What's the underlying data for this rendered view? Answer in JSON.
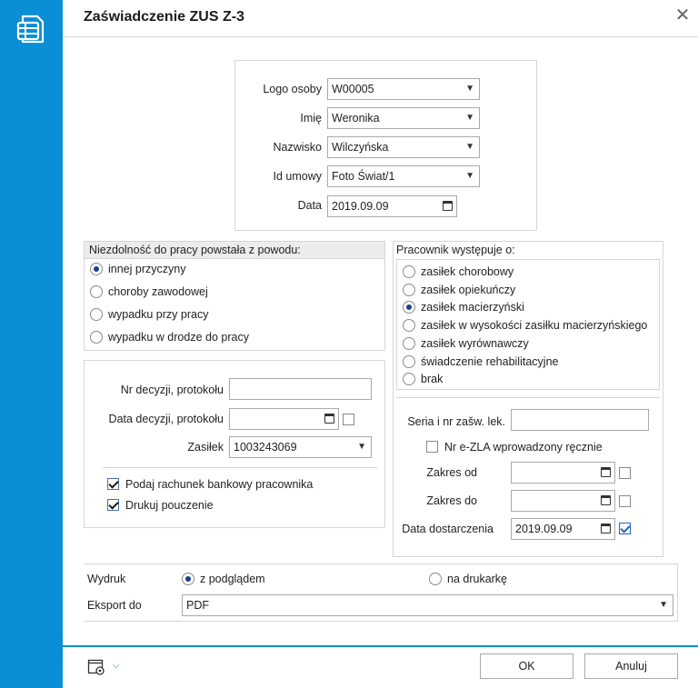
{
  "window": {
    "title": "Zaświadczenie ZUS Z-3",
    "close": "✕"
  },
  "header_fields": {
    "logo_label": "Logo osoby",
    "logo_value": "W00005",
    "imie_label": "Imię",
    "imie_value": "Weronika",
    "nazwisko_label": "Nazwisko",
    "nazwisko_value": "Wilczyńska",
    "umowa_label": "Id umowy",
    "umowa_value": "Foto Świat/1",
    "data_label": "Data",
    "data_value": "2019.09.09"
  },
  "niezdolnosc": {
    "title": "Niezdolność do pracy powstała z powodu:",
    "options": [
      "innej przyczyny",
      "choroby zawodowej",
      "wypadku przy pracy",
      "wypadku w drodze do pracy"
    ],
    "selected": 0
  },
  "decyzja": {
    "nr_label": "Nr decyzji, protokołu",
    "nr_value": "",
    "data_label": "Data decyzji, protokołu",
    "data_value": "",
    "zasilek_label": "Zasiłek",
    "zasilek_value": "1003243069",
    "rachunek_label": "Podaj rachunek bankowy pracownika",
    "rachunek_checked": true,
    "pouczenie_label": "Drukuj pouczenie",
    "pouczenie_checked": true
  },
  "pracownik": {
    "title": "Pracownik występuje o:",
    "options": [
      "zasiłek chorobowy",
      "zasiłek opiekuńczy",
      "zasiłek macierzyński",
      "zasiłek w wysokości zasiłku macierzyńskiego",
      "zasiłek wyrównawczy",
      "świadczenie rehabilitacyjne",
      "brak"
    ],
    "selected": 2
  },
  "zwolnienie": {
    "seria_label": "Seria i nr zašw. lek.",
    "seria_value": "",
    "ezla_label": "Nr e-ZLA wprowadzony ręcznie",
    "ezla_checked": false,
    "od_label": "Zakres od",
    "od_value": "",
    "do_label": "Zakres do",
    "do_value": "",
    "dostarczenia_label": "Data dostarczenia",
    "dostarczenia_value": "2019.09.09",
    "dostarczenia_checked": true
  },
  "wydruk": {
    "label": "Wydruk",
    "opt_podglad": "z podglądem",
    "opt_drukarka": "na drukarkę",
    "selected": "podglad",
    "eksport_label": "Eksport do",
    "eksport_value": "PDF"
  },
  "footer": {
    "ok": "OK",
    "cancel": "Anuluj"
  }
}
